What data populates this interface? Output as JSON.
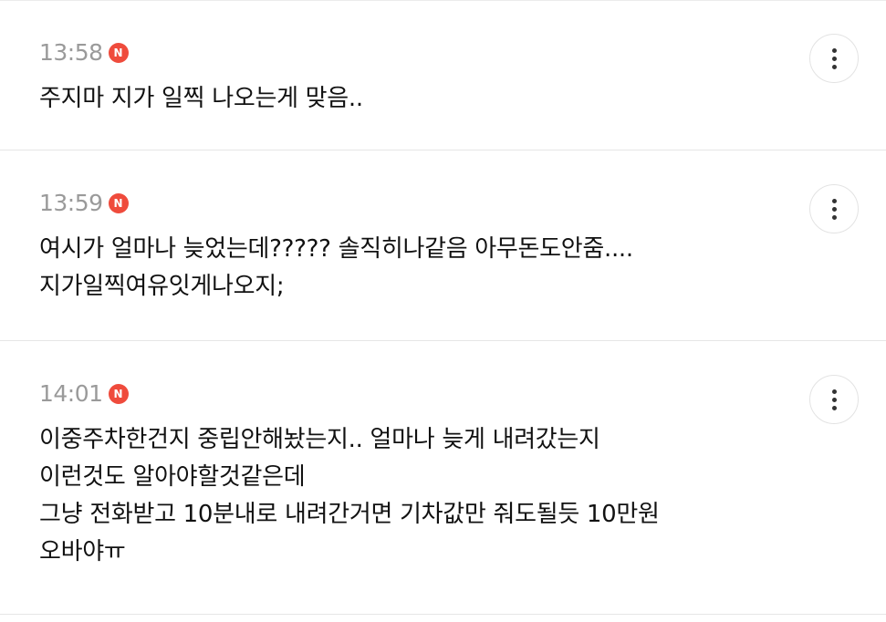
{
  "badge_label": "N",
  "comments": [
    {
      "time": "13:58",
      "lines": [
        "주지마 지가 일찍 나오는게 맞음.."
      ]
    },
    {
      "time": "13:59",
      "lines": [
        "여시가 얼마나 늦었는데????? 솔직히나같음 아무돈도안줌....",
        "지가일찍여유잇게나오지;"
      ]
    },
    {
      "time": "14:01",
      "lines": [
        "이중주차한건지 중립안해놨는지.. 얼마나 늦게 내려갔는지",
        "이런것도 알아야할것같은데",
        "그냥 전화받고 10분내로 내려간거면 기차값만 줘도될듯 10만원",
        "오바야ㅠ"
      ]
    }
  ],
  "colors": {
    "badge": "#ef4b3c",
    "timestamp": "#9a9a9a",
    "divider": "#e6e6e6"
  },
  "icons": {
    "more": "vertical-ellipsis-icon",
    "new": "new-badge-icon"
  }
}
